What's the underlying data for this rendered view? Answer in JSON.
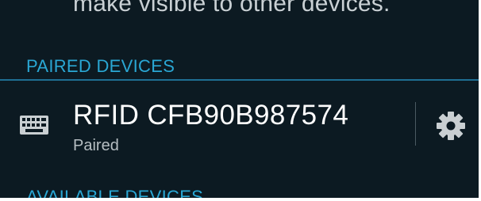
{
  "top_hint": "make visible to other devices.",
  "sections": {
    "paired_header": "PAIRED DEVICES",
    "available_header": "AVAILABLE DEVICES"
  },
  "paired_device": {
    "name": "RFID CFB90B987574",
    "status": "Paired",
    "icon": "keyboard-icon",
    "action_icon": "gear-icon"
  },
  "colors": {
    "background": "#0c1a22",
    "accent": "#2aa7d4",
    "divider": "#1f6f93",
    "primary_text": "#ffffff",
    "secondary_text": "#b6bec2"
  }
}
